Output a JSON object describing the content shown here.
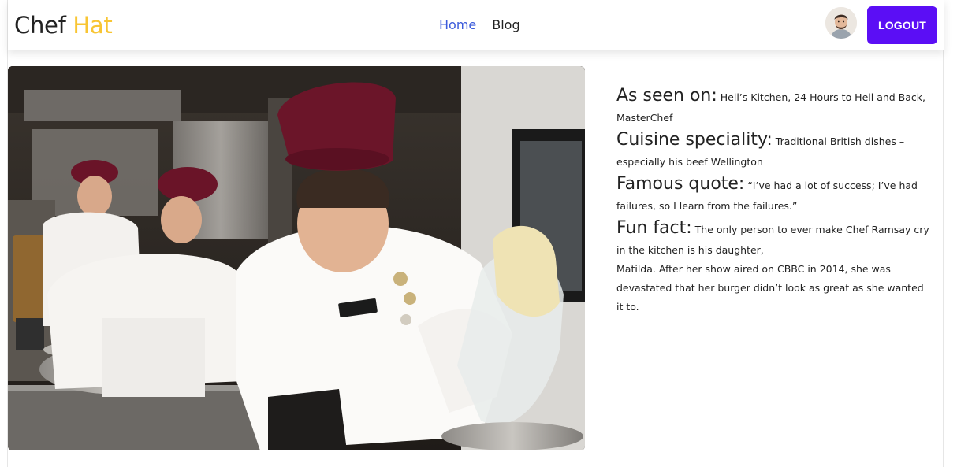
{
  "brand": {
    "name": "Chef",
    "accent": "Hat"
  },
  "nav": {
    "items": [
      {
        "label": "Home",
        "active": true
      },
      {
        "label": "Blog",
        "active": false
      }
    ]
  },
  "user": {
    "avatar_icon": "user-avatar"
  },
  "logout_label": "LOGOUT",
  "hero": {
    "image_icon": "chef-kitchen-photo"
  },
  "info": {
    "seen_on": {
      "label": "As seen on:",
      "text": " Hell’s Kitchen, 24 Hours to Hell and Back, MasterChef"
    },
    "cuisine": {
      "label": "Cuisine speciality:",
      "text": " Traditional British dishes – especially his beef Wellington"
    },
    "quote": {
      "label": "Famous quote:",
      "text": " “I’ve had a lot of success; I’ve had failures, so I learn from the failures.”"
    },
    "fun_fact": {
      "label": "Fun fact:",
      "text": " The only person to ever make Chef Ramsay cry in the kitchen is his daughter,"
    },
    "fun_fact_more": "Matilda. After her show aired on CBBC in 2014, she was devastated that her burger didn’t look as great as she wanted it to."
  },
  "colors": {
    "accent": "#f8c533",
    "primary": "#5b0ef5",
    "link": "#3b5bdb"
  }
}
